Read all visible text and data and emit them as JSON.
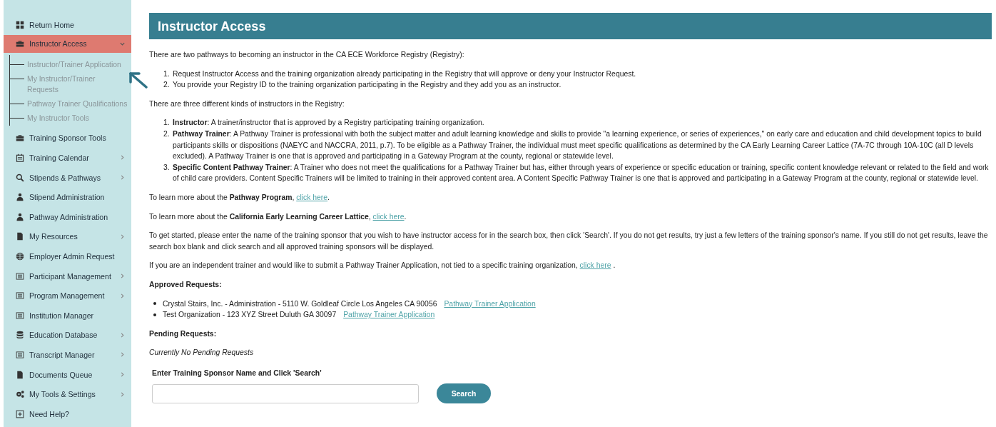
{
  "sidebar": {
    "items": [
      {
        "label": "Return Home",
        "kind": "grid",
        "selected": false
      },
      {
        "label": "Instructor Access",
        "kind": "toolbox",
        "selected": true,
        "expanded": true,
        "children": [
          {
            "label": "Instructor/Trainer Application"
          },
          {
            "label": "My Instructor/Trainer Requests"
          },
          {
            "label": "Pathway Trainer Qualifications"
          },
          {
            "label": "My Instructor Tools"
          }
        ]
      },
      {
        "label": "Training Sponsor Tools",
        "kind": "toolbox",
        "selected": false
      },
      {
        "label": "Training Calendar",
        "kind": "calendar",
        "selected": false,
        "expanded": false
      },
      {
        "label": "Stipends & Pathways",
        "kind": "search",
        "selected": false,
        "expanded": false
      },
      {
        "label": "Stipend Administration",
        "kind": "person",
        "selected": false
      },
      {
        "label": "Pathway Administration",
        "kind": "person",
        "selected": false
      },
      {
        "label": "My Resources",
        "kind": "file",
        "selected": false,
        "expanded": false
      },
      {
        "label": "Employer Admin Request",
        "kind": "globe",
        "selected": false
      },
      {
        "label": "Participant Management",
        "kind": "list",
        "selected": false,
        "expanded": false
      },
      {
        "label": "Program Management",
        "kind": "list",
        "selected": false,
        "expanded": false
      },
      {
        "label": "Institution Manager",
        "kind": "list",
        "selected": false
      },
      {
        "label": "Education Database",
        "kind": "database",
        "selected": false,
        "expanded": false
      },
      {
        "label": "Transcript Manager",
        "kind": "list",
        "selected": false,
        "expanded": false
      },
      {
        "label": "Documents Queue",
        "kind": "file",
        "selected": false,
        "expanded": false
      },
      {
        "label": "My Tools & Settings",
        "kind": "gears",
        "selected": false,
        "expanded": false
      },
      {
        "label": "Need Help?",
        "kind": "plus",
        "selected": false
      }
    ]
  },
  "main": {
    "title": "Instructor Access",
    "intro": "There are two pathways to becoming an instructor in the CA ECE Workforce Registry (Registry):",
    "pathways": [
      {
        "number": "1.",
        "text": "Request Instructor Access and the training organization already participating in the Registry that will approve or deny your Instructor Request."
      },
      {
        "number": "2.",
        "text": "You provide your Registry ID to the training organization participating in the Registry and they add you as an instructor."
      }
    ],
    "kinds_intro": "There are three different kinds of instructors in the Registry:",
    "kinds": [
      {
        "number": "1.",
        "text": "**Instructor**: A trainer/instructor that is approved by a Registry participating training organization."
      },
      {
        "number": "2.",
        "text": "**Pathway Trainer**: A Pathway Trainer is professional with both the subject matter and adult learning knowledge and skills to provide \"a learning experience, or series of experiences,\" on early care and education and child development topics to build participants skills or dispositions (NAEYC and NACCRA, 2011, p.7). To be eligible as a Pathway Trainer, the individual must meet specific qualifications as determined by the CA Early Learning Career Lattice (7A-7C through 10A-10C (all D levels excluded). A Pathway Trainer is one that is approved and participating in a Gateway Program at the county, regional or statewide level."
      },
      {
        "number": "3.",
        "text": "**Specific Content Pathway Trainer**: A Trainer who does not meet the qualifications for a Pathway Trainer but has, either through years of experience or specific education or training, specific content knowledge relevant or related to the field and work of child care providers. Content Specific Trainers will be limited to training in their approved content area. A Content Specific Pathway Trainer is one that is approved and participating in a Gateway Program at the county, regional or statewide level."
      }
    ],
    "paragraphs": [
      {
        "kind": "link",
        "text": "To learn more about the **Pathway Program**, ",
        "link": "click here",
        "after": "."
      },
      {
        "kind": "link",
        "text": "To learn more about the **California Early Learning Career Lattice**, ",
        "link": "click here",
        "after": "."
      },
      {
        "kind": "plain",
        "text": "To get started, please enter the name of the training sponsor that you wish to have instructor access for in the search box, then click 'Search'. If you do not get results, try just a few letters of the training sponsor's name. If you still do not get results, leave the search box blank and click search and all approved training sponsors will be displayed."
      },
      {
        "kind": "link",
        "text": "If you are an independent trainer and would like to submit a Pathway Trainer Application, not tied to a specific training organization, ",
        "link": "click here",
        "after": " ."
      }
    ],
    "approved_heading": "Approved Requests:",
    "approved": [
      {
        "text": "Crystal Stairs, Inc. - Administration - 5110 W. Goldleaf Circle Los Angeles CA 90056",
        "link": "Pathway Trainer Application"
      },
      {
        "text": "Test Organization - 123 XYZ Street Duluth GA 30097",
        "link": "Pathway Trainer Application"
      }
    ],
    "pending_heading": "Pending Requests:",
    "pending_note": "Currently No Pending Requests",
    "search_label": "Enter Training Sponsor Name and Click 'Search'",
    "search_button": "Search"
  }
}
